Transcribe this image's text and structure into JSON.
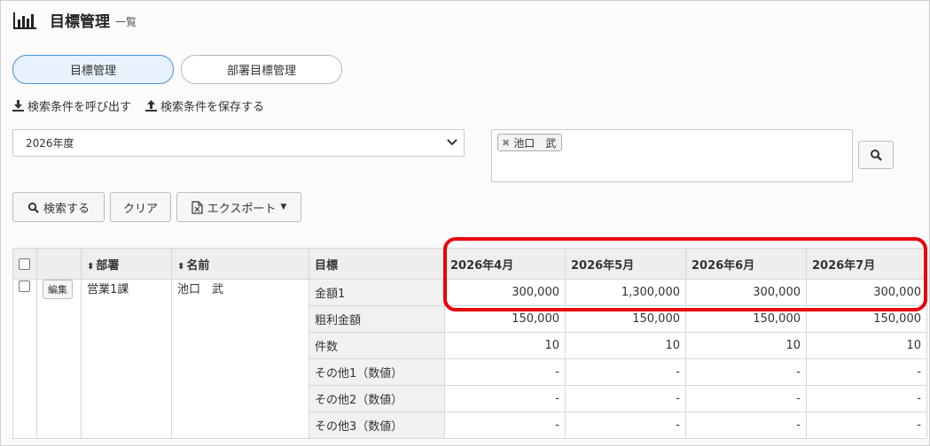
{
  "header": {
    "title": "目標管理",
    "subtitle": "一覧",
    "icon": "bar-chart-icon"
  },
  "tabs": [
    {
      "label": "目標管理",
      "active": true
    },
    {
      "label": "部署目標管理",
      "active": false
    }
  ],
  "search_links": {
    "load": "検索条件を呼び出す",
    "save": "検索条件を保存する"
  },
  "filters": {
    "fiscal_year": "2026年度",
    "member_tag": "池口　武"
  },
  "buttons": {
    "search": "検索する",
    "clear": "クリア",
    "export": "エクスポート"
  },
  "table": {
    "headers": {
      "department": "部署",
      "name": "名前",
      "goal": "目標",
      "months": [
        "2026年4月",
        "2026年5月",
        "2026年6月",
        "2026年7月"
      ]
    },
    "record": {
      "edit_label": "編集",
      "department": "営業1課",
      "name": "池口　武"
    },
    "rows": [
      {
        "goal": "金額1",
        "values": [
          "300,000",
          "1,300,000",
          "300,000",
          "300,000"
        ]
      },
      {
        "goal": "粗利金額",
        "values": [
          "150,000",
          "150,000",
          "150,000",
          "150,000"
        ]
      },
      {
        "goal": "件数",
        "values": [
          "10",
          "10",
          "10",
          "10"
        ]
      },
      {
        "goal": "その他1（数値）",
        "values": [
          "-",
          "-",
          "-",
          "-"
        ]
      },
      {
        "goal": "その他2（数値）",
        "values": [
          "-",
          "-",
          "-",
          "-"
        ]
      },
      {
        "goal": "その他3（数値）",
        "values": [
          "-",
          "-",
          "-",
          "-"
        ]
      }
    ]
  },
  "colors": {
    "accent": "#4a90d9",
    "highlight": "#e8000d"
  }
}
